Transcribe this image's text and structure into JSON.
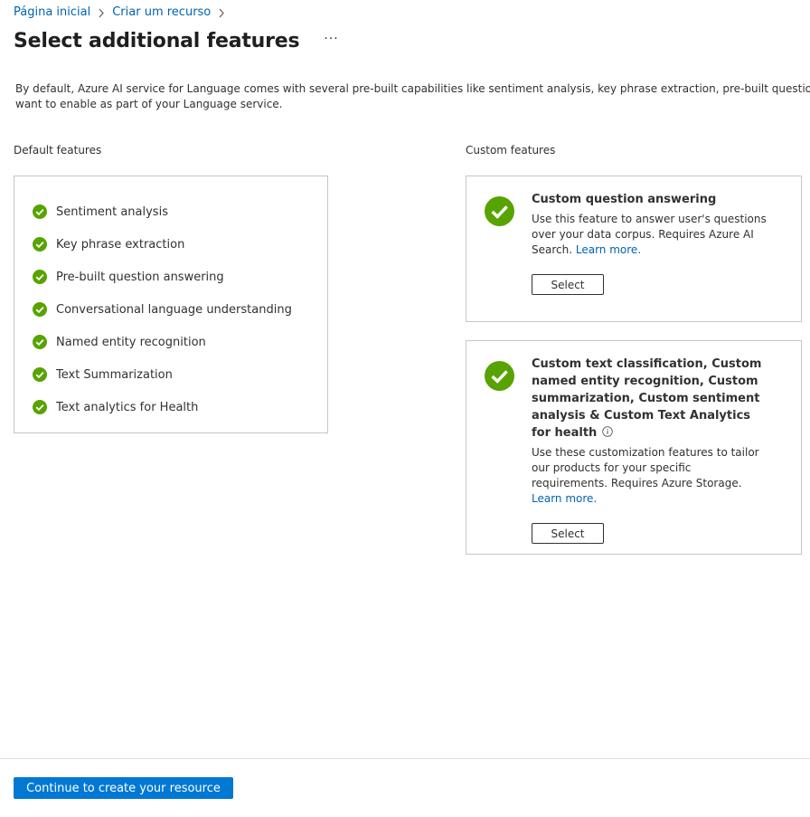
{
  "breadcrumb": [
    {
      "label": "Página inicial"
    },
    {
      "label": "Criar um recurso"
    }
  ],
  "page": {
    "title": "Select additional features",
    "more_label": "···",
    "description": "By default, Azure AI service for Language comes with several pre-built capabilities like sentiment analysis, key phrase extraction, pre-built question answering, etc. Some customizable features below require additional services like Azure AI Search, Blob storage, etc. to be provisioned as well. Select the custom features you\nwant to enable as part of your Language service."
  },
  "default_features": {
    "heading": "Default features",
    "items": [
      "Sentiment analysis",
      "Key phrase extraction",
      "Pre-built question answering",
      "Conversational language understanding",
      "Named entity recognition",
      "Text Summarization",
      "Text analytics for Health"
    ]
  },
  "custom_features": {
    "heading": "Custom features",
    "cards": [
      {
        "title": "Custom question answering",
        "description": "Use this feature to answer user's questions over your data corpus. Requires Azure AI Search.",
        "link_label": "Learn more.",
        "select_label": "Select"
      },
      {
        "title": "Custom text classification, Custom named entity recognition, Custom summarization, Custom sentiment analysis & Custom Text Analytics for health",
        "description": "Use these customization features to tailor our products for your specific requirements. Requires Azure Storage.",
        "link_label": "Learn more.",
        "select_label": "Select"
      }
    ]
  },
  "footer": {
    "primary_label": "Continue to create your resource"
  },
  "colors": {
    "accent": "#0078d4",
    "link": "#0063b1",
    "check": "#57a300",
    "border": "#c8c6c4"
  },
  "icons": {
    "breadcrumb_separator": "chevron-right-icon",
    "feature_check": "check-circle-icon",
    "info": "info-icon"
  }
}
